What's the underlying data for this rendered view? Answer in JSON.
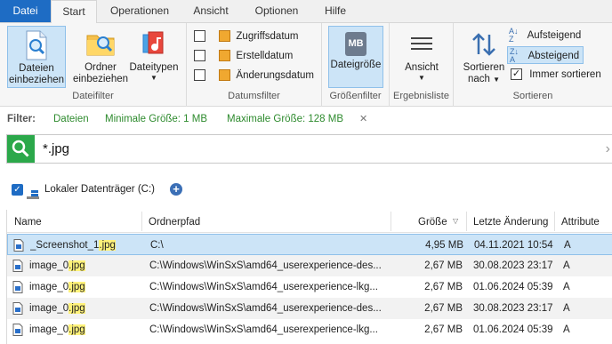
{
  "tabs": [
    "Datei",
    "Start",
    "Operationen",
    "Ansicht",
    "Optionen",
    "Hilfe"
  ],
  "ribbon": {
    "dateifilter": {
      "label": "Dateifilter",
      "btn_dateien": "Dateien einbeziehen",
      "btn_ordner": "Ordner einbeziehen",
      "btn_dateitypen": "Dateitypen"
    },
    "datumsfilter": {
      "label": "Datumsfilter",
      "zugriff": "Zugriffsdatum",
      "erstell": "Erstelldatum",
      "aenderung": "Änderungsdatum"
    },
    "groessenfilter": {
      "label": "Größenfilter",
      "btn": "Dateigröße",
      "icon_text": "MB"
    },
    "ergebnisliste": {
      "label": "Ergebnisliste",
      "btn": "Ansicht"
    },
    "sortieren": {
      "label": "Sortieren",
      "btn": "Sortieren nach",
      "auf": "Aufsteigend",
      "ab": "Absteigend",
      "immer": "Immer sortieren"
    }
  },
  "filter": {
    "label": "Filter:",
    "items": [
      "Dateien",
      "Minimale Größe: 1 MB",
      "Maximale Größe: 128 MB"
    ],
    "close": "✕"
  },
  "search": {
    "value": "*.jpg"
  },
  "drive": {
    "label": "Lokaler Datenträger (C:)"
  },
  "table": {
    "headers": {
      "name": "Name",
      "path": "Ordnerpfad",
      "size": "Größe",
      "date": "Letzte Änderung",
      "attr": "Attribute"
    },
    "rows": [
      {
        "name_pre": "_Screenshot_1",
        "name_hl": ".jpg",
        "path": "C:\\",
        "size": "4,95 MB",
        "date": "04.11.2021 10:54",
        "attr": "A"
      },
      {
        "name_pre": "image_0",
        "name_hl": ".jpg",
        "path": "C:\\Windows\\WinSxS\\amd64_userexperience-des...",
        "size": "2,67 MB",
        "date": "30.08.2023 23:17",
        "attr": "A"
      },
      {
        "name_pre": "image_0",
        "name_hl": ".jpg",
        "path": "C:\\Windows\\WinSxS\\amd64_userexperience-lkg...",
        "size": "2,67 MB",
        "date": "01.06.2024 05:39",
        "attr": "A"
      },
      {
        "name_pre": "image_0",
        "name_hl": ".jpg",
        "path": "C:\\Windows\\WinSxS\\amd64_userexperience-des...",
        "size": "2,67 MB",
        "date": "30.08.2023 23:17",
        "attr": "A"
      },
      {
        "name_pre": "image_0",
        "name_hl": ".jpg",
        "path": "C:\\Windows\\WinSxS\\amd64_userexperience-lkg...",
        "size": "2,67 MB",
        "date": "01.06.2024 05:39",
        "attr": "A"
      }
    ]
  },
  "colors": {
    "accent": "#1e6cc4",
    "selection": "#cce4f7",
    "filter_green": "#2e8b2e",
    "search_green": "#2ba84a",
    "highlight": "#fff27a"
  }
}
